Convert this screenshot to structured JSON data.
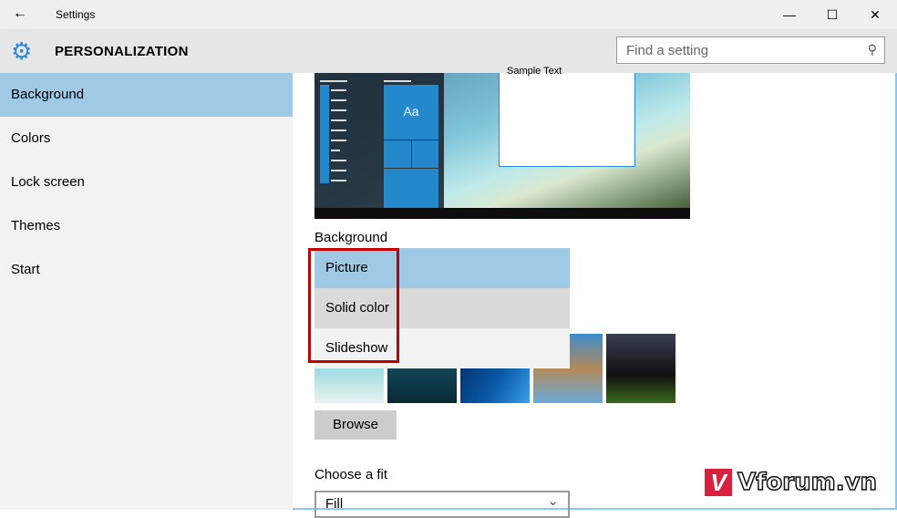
{
  "window": {
    "title": "Settings",
    "back_icon": "arrow-left-icon",
    "minimize": "—",
    "maximize": "☐",
    "close": "✕"
  },
  "header": {
    "title": "PERSONALIZATION",
    "search_placeholder": "Find a setting"
  },
  "sidebar": {
    "items": [
      {
        "label": "Background",
        "selected": true
      },
      {
        "label": "Colors"
      },
      {
        "label": "Lock screen"
      },
      {
        "label": "Themes"
      },
      {
        "label": "Start"
      }
    ]
  },
  "preview": {
    "tile_text": "Aa",
    "sample_text": "Sample Text"
  },
  "background": {
    "label": "Background",
    "options": [
      "Picture",
      "Solid color",
      "Slideshow"
    ],
    "selected": "Picture",
    "highlighted": "Solid color"
  },
  "browse_label": "Browse",
  "fit": {
    "label": "Choose a fit",
    "value": "Fill"
  },
  "watermark": "Vforum.vn",
  "colors": {
    "accent": "#2389cc",
    "selection": "#9fc9e4",
    "annotation": "#c00000"
  }
}
